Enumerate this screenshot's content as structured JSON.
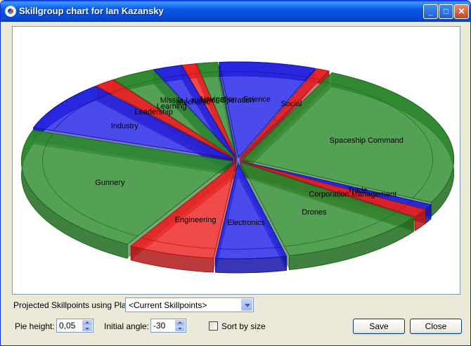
{
  "window": {
    "title": "Skillgroup chart for Ian Kazansky"
  },
  "colors": {
    "green": "#2e8b2e",
    "blue": "#2323e6",
    "red": "#ee2222",
    "titlebar": "#0a58e6"
  },
  "chart_data": {
    "type": "pie",
    "categories": [
      "Spaceship Command",
      "Trade",
      "Corporation Management",
      "Drones",
      "Electronics",
      "Engineering",
      "Gunnery",
      "Industry",
      "Leadership",
      "Learning",
      "Mechanic",
      "Missile Launcher Operation",
      "Navigation",
      "Science",
      "Social"
    ],
    "colors": [
      "green",
      "blue",
      "red",
      "green",
      "blue",
      "red",
      "green",
      "blue",
      "red",
      "green",
      "blue",
      "red",
      "green",
      "blue",
      "red"
    ],
    "values": [
      25.5,
      0.9,
      1.4,
      11.6,
      5.4,
      6.6,
      22,
      8.4,
      1.6,
      3.4,
      2.2,
      1.1,
      1.6,
      7.4,
      1
    ]
  },
  "controls": {
    "plan_label": "Projected Skillpoints using Plan:",
    "plan_value": "<Current Skillpoints>",
    "pie_height_label": "Pie height:",
    "pie_height_value": "0,05",
    "initial_angle_label": "Initial angle:",
    "initial_angle_value": "-30",
    "sort_label": "Sort by size",
    "save_label": "Save",
    "close_label": "Close"
  },
  "icons": {
    "app": "pie-chart-icon",
    "minimize": "minimize-icon",
    "maximize": "maximize-icon",
    "close": "close-icon"
  }
}
